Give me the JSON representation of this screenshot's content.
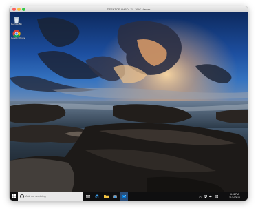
{
  "window": {
    "title": "DESKTOP-8HBD1J1 - VNC Viewer"
  },
  "desktop_icons": [
    {
      "label": "Recycle Bin",
      "icon": "recycle-bin-icon"
    },
    {
      "label": "Google Chrome",
      "icon": "chrome-icon"
    }
  ],
  "taskbar": {
    "search_placeholder": "Ask me anything",
    "pinned": [
      "task-view-icon",
      "edge-icon",
      "file-explorer-icon",
      "store-icon",
      "mail-icon"
    ],
    "tray": [
      "chevron-up-icon",
      "network-icon",
      "volume-icon",
      "notifications-icon"
    ],
    "time": "6:01 PM",
    "date": "11/14/2015"
  },
  "colors": {
    "taskbar": "#0f0f10",
    "search_box": "#e8e8e8",
    "accent": "#0078d7"
  }
}
